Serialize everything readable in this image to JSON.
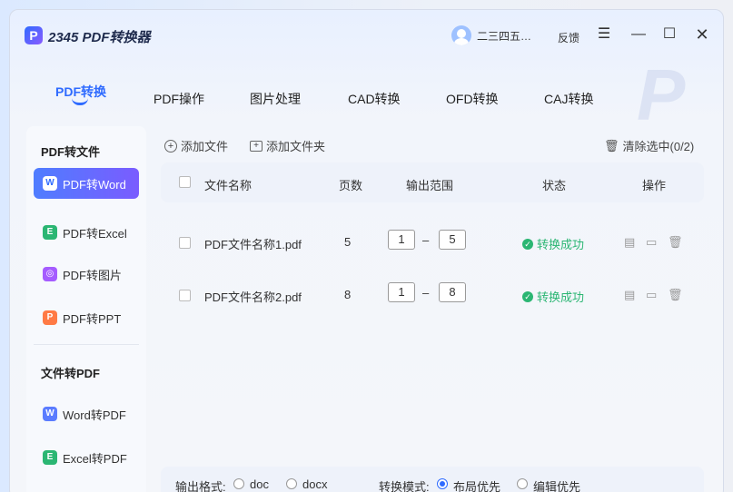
{
  "app": {
    "title": "2345 PDF转换器",
    "logo_letter": "P",
    "username": "二三四五…",
    "feedback": "反馈",
    "accent_color": "#2f6bff",
    "success_color": "#2bb673"
  },
  "icons": {
    "menu": "☰",
    "minimize": "—",
    "maximize": "☐",
    "close": "✕"
  },
  "tabs": [
    {
      "label": "PDF转换",
      "active": true
    },
    {
      "label": "PDF操作"
    },
    {
      "label": "图片处理"
    },
    {
      "label": "CAD转换"
    },
    {
      "label": "OFD转换"
    },
    {
      "label": "CAJ转换"
    }
  ],
  "sidebar": {
    "group1": "PDF转文件",
    "items1": [
      {
        "label": "PDF转Word",
        "icon": "W",
        "color": "#2f6bff",
        "active": true
      },
      {
        "label": "PDF转Excel",
        "icon": "E",
        "color": "#2bb673"
      },
      {
        "label": "PDF转图片",
        "icon": "◎",
        "color": "#a55cff"
      },
      {
        "label": "PDF转PPT",
        "icon": "P",
        "color": "#ff7a45"
      }
    ],
    "group2": "文件转PDF",
    "items2": [
      {
        "label": "Word转PDF",
        "icon": "W",
        "color": "#5b7cff"
      },
      {
        "label": "Excel转PDF",
        "icon": "E",
        "color": "#2bb673"
      }
    ]
  },
  "toolbar": {
    "add_file": "添加文件",
    "add_folder": "添加文件夹",
    "clear_selected": "清除选中(0/2)"
  },
  "table": {
    "headers": {
      "name": "文件名称",
      "pages": "页数",
      "range": "输出范围",
      "status": "状态",
      "ops": "操作"
    },
    "rows": [
      {
        "name": "PDF文件名称1.pdf",
        "pages": "5",
        "from": "1",
        "to": "5",
        "status": "转换成功"
      },
      {
        "name": "PDF文件名称2.pdf",
        "pages": "8",
        "from": "1",
        "to": "8",
        "status": "转换成功"
      }
    ],
    "range_sep": "–"
  },
  "bottom": {
    "format_label": "输出格式:",
    "format_options": [
      "doc",
      "docx"
    ],
    "mode_label": "转换模式:",
    "mode_options": [
      "布局优先",
      "编辑优先"
    ],
    "mode_selected": "布局优先"
  }
}
